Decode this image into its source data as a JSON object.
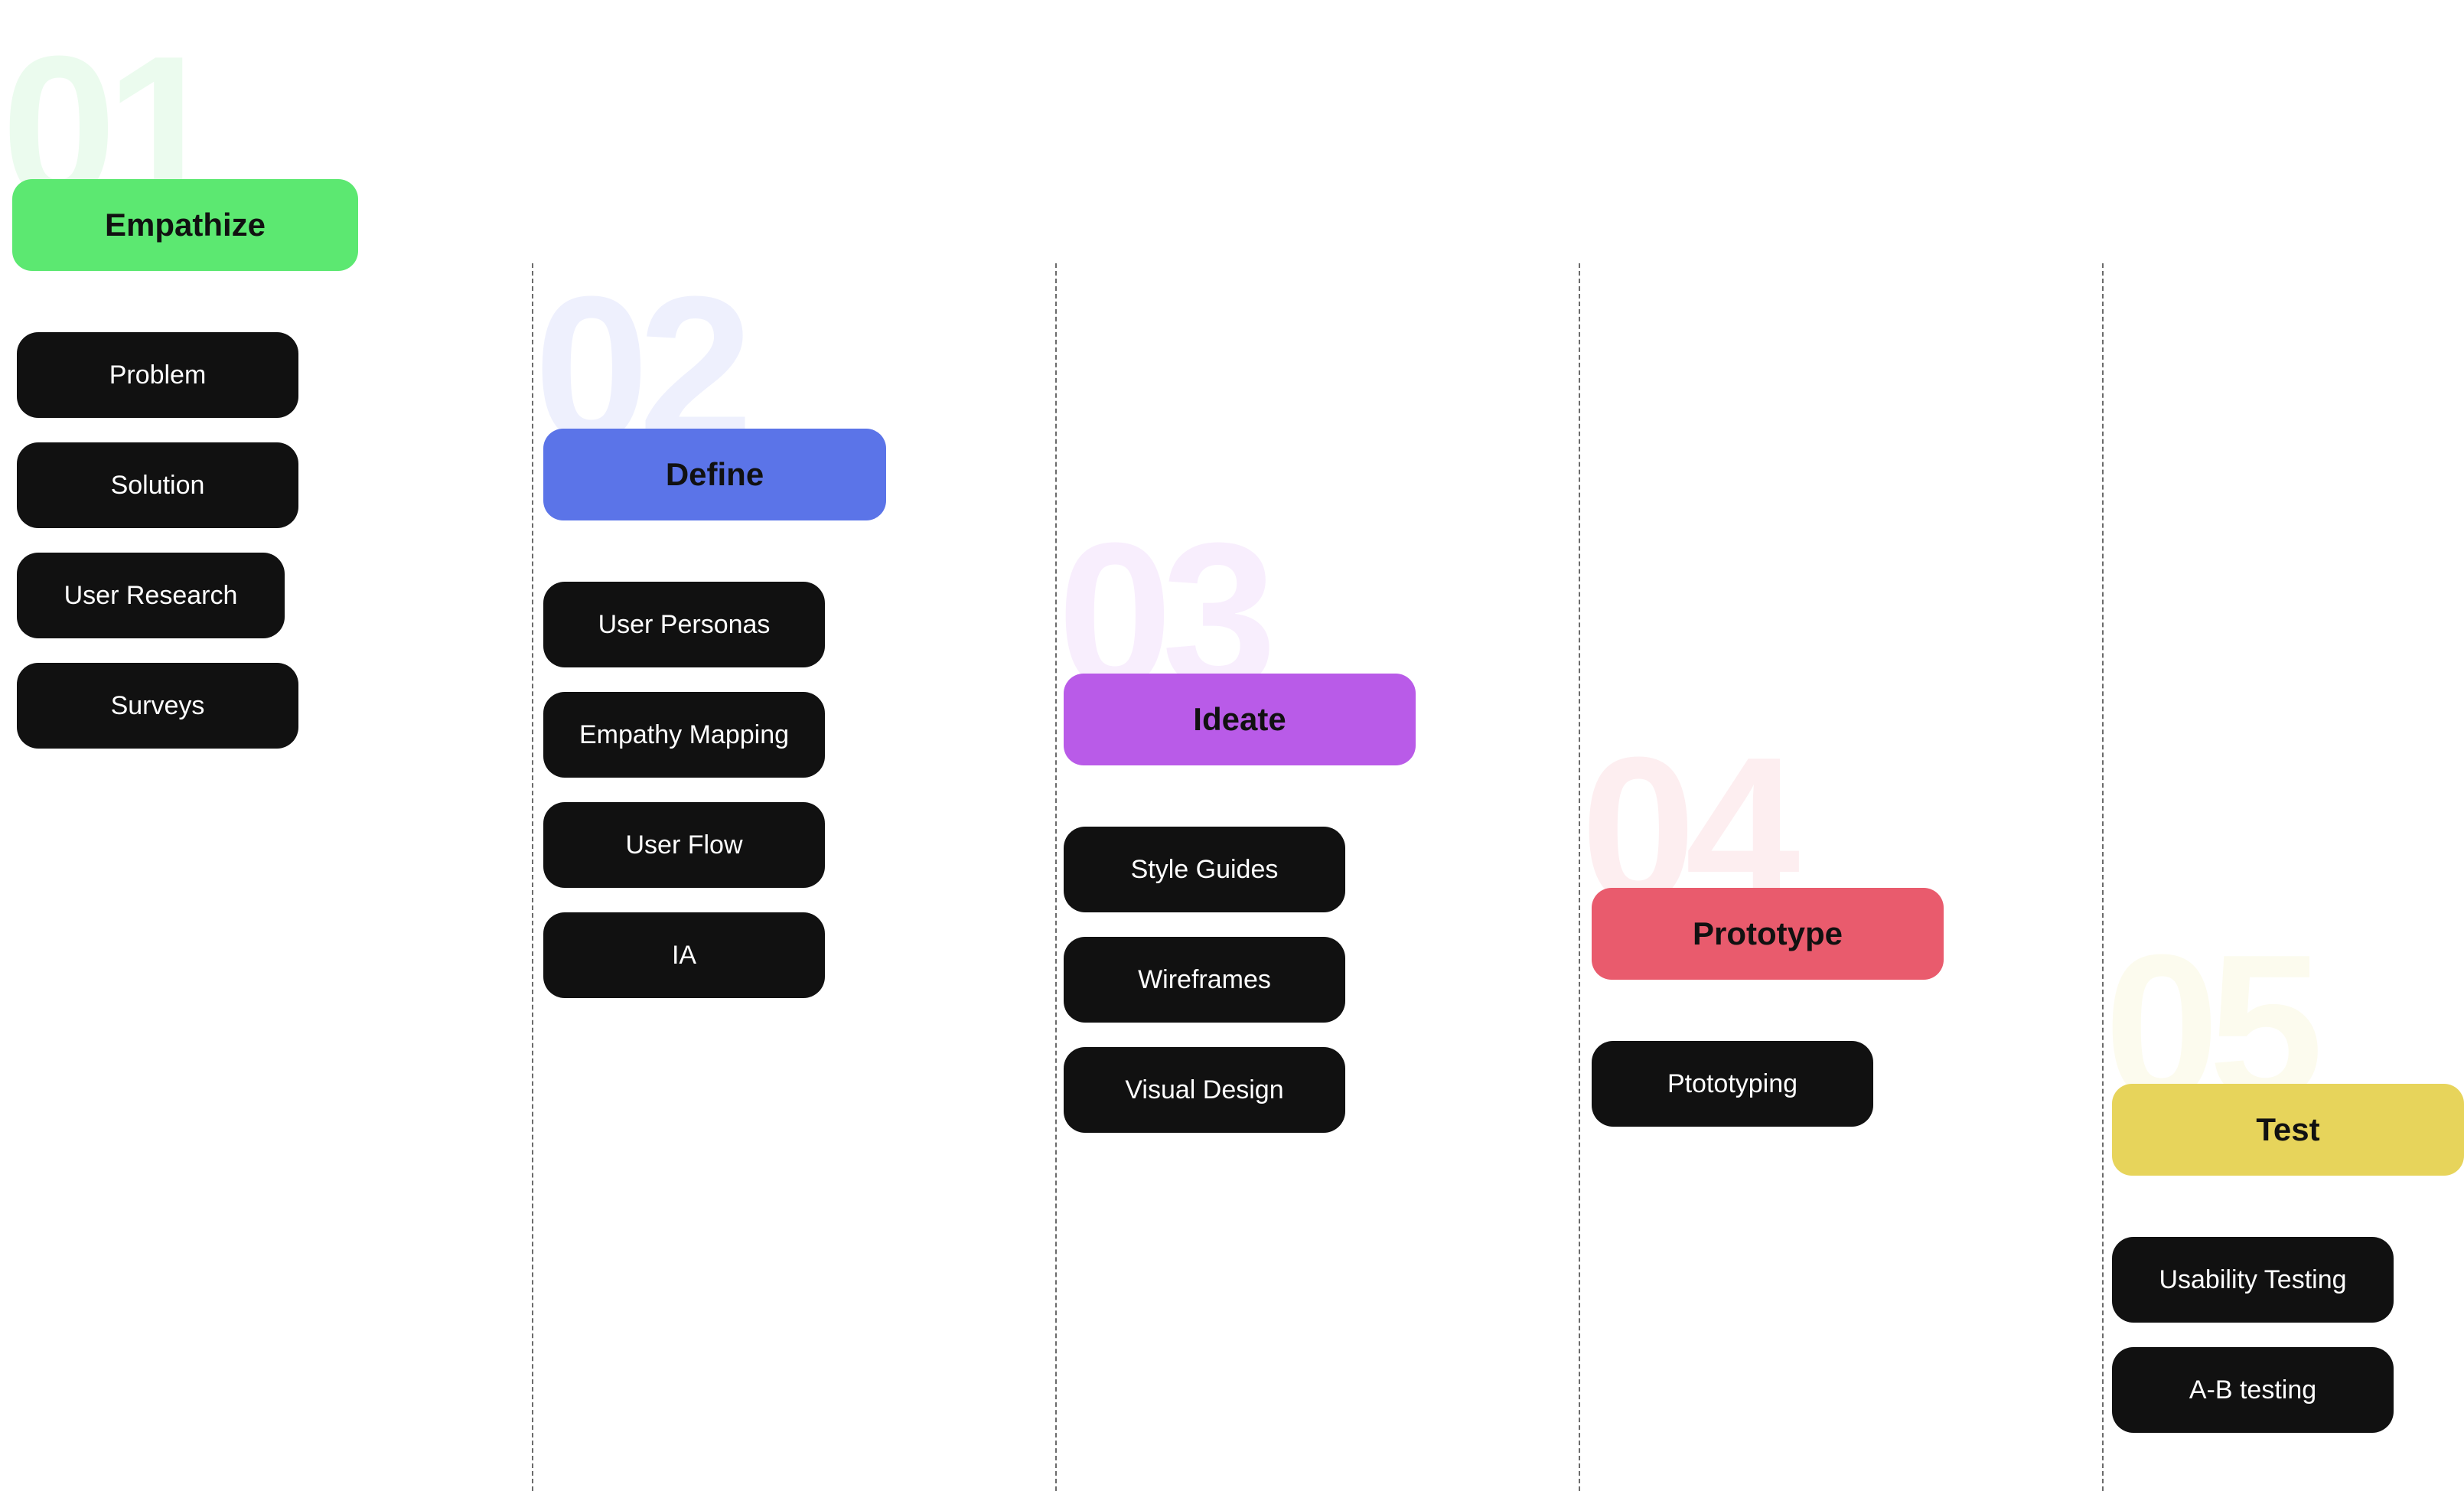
{
  "colors": {
    "empathize": "#5ce871",
    "define": "#5b74e8",
    "ideate": "#b95be8",
    "prototype": "#e95b6d",
    "test": "#e7d45b",
    "item_bg": "#111111",
    "item_text": "#ffffff",
    "divider": "#6b6b6b"
  },
  "stages": [
    {
      "number": "01",
      "label": "Empathize",
      "items": [
        "Problem",
        "Solution",
        "User Research",
        "Surveys"
      ]
    },
    {
      "number": "02",
      "label": "Define",
      "items": [
        "User Personas",
        "Empathy Mapping",
        "User Flow",
        "IA"
      ]
    },
    {
      "number": "03",
      "label": "Ideate",
      "items": [
        "Style Guides",
        "Wireframes",
        "Visual Design"
      ]
    },
    {
      "number": "04",
      "label": "Prototype",
      "items": [
        "Ptototyping"
      ]
    },
    {
      "number": "05",
      "label": "Test",
      "items": [
        "Usability Testing",
        "A-B testing"
      ]
    }
  ]
}
